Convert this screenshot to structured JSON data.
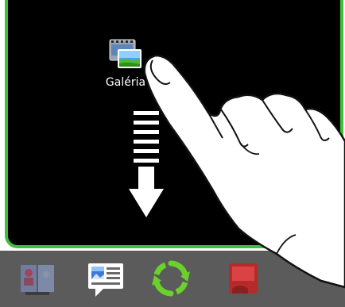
{
  "app_shortcut": {
    "label": "Galéria",
    "icon": "gallery-icon"
  },
  "gesture": {
    "arrow_icon": "drag-down-arrow-icon",
    "hand_icon": "pointing-hand-icon"
  },
  "dock": {
    "items": [
      {
        "icon": "contacts-icon"
      },
      {
        "icon": "messages-icon"
      },
      {
        "icon": "sync-icon"
      },
      {
        "icon": "phone-icon"
      }
    ]
  },
  "colors": {
    "panel_border": "#3fbf3a",
    "panel_bg": "#000000",
    "dock_bg": "#5b5b5b",
    "sync_green": "#6bd12b"
  }
}
